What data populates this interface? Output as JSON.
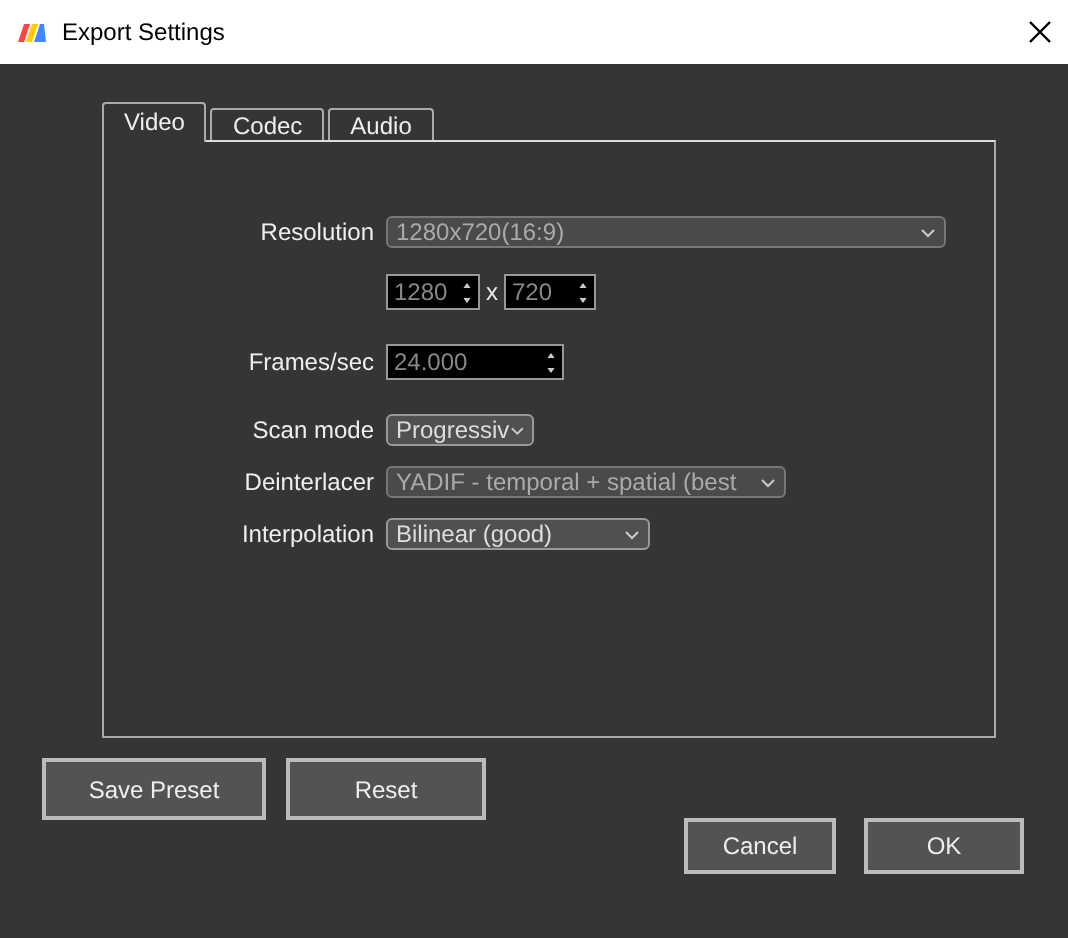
{
  "window": {
    "title": "Export Settings"
  },
  "tabs": [
    {
      "label": "Video",
      "selected": true
    },
    {
      "label": "Codec",
      "selected": false
    },
    {
      "label": "Audio",
      "selected": false
    }
  ],
  "video": {
    "resolution": {
      "label": "Resolution",
      "value": "1280x720(16:9)",
      "disabled": true
    },
    "width": {
      "value": "1280",
      "disabled": true
    },
    "separator": "x",
    "height": {
      "value": "720",
      "disabled": true
    },
    "frames": {
      "label": "Frames/sec",
      "value": "24.000",
      "disabled": true
    },
    "scan_mode": {
      "label": "Scan mode",
      "value": "Progressiv",
      "disabled": false
    },
    "deinterlacer": {
      "label": "Deinterlacer",
      "value": "YADIF - temporal + spatial (best",
      "disabled": true
    },
    "interpolation": {
      "label": "Interpolation",
      "value": "Bilinear (good)",
      "disabled": false
    }
  },
  "left_buttons": [
    "Save Preset",
    "Reset"
  ],
  "right_buttons": [
    "Cancel",
    "OK"
  ]
}
